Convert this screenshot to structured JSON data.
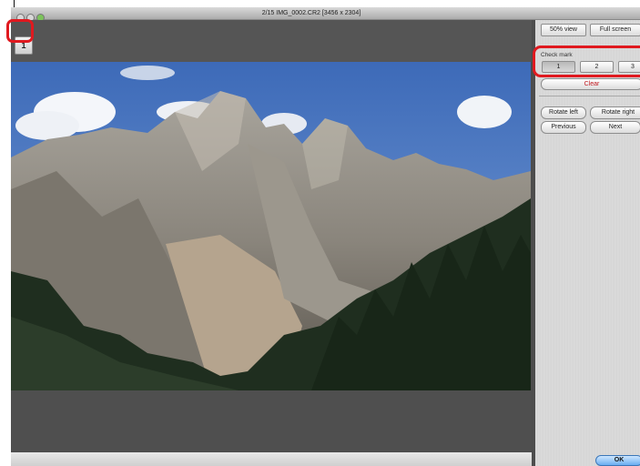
{
  "window": {
    "title": "2/15 IMG_0002.CR2 [3456 x 2304]"
  },
  "image_area": {
    "view_button_glyph": "1",
    "view_button_icon": "single-view-icon"
  },
  "panel": {
    "view50_label": "50% view",
    "fullscreen_label": "Full screen",
    "check_mark_label": "Check mark",
    "checks": [
      "1",
      "2",
      "3"
    ],
    "clear_label": "Clear",
    "rotate_left_label": "Rotate left",
    "rotate_right_label": "Rotate right",
    "previous_label": "Previous",
    "next_label": "Next",
    "ok_label": "OK"
  },
  "colors": {
    "callout_red": "#e0191f",
    "ok_blue": "#6aaef2",
    "clear_text_red": "#c2191f"
  }
}
